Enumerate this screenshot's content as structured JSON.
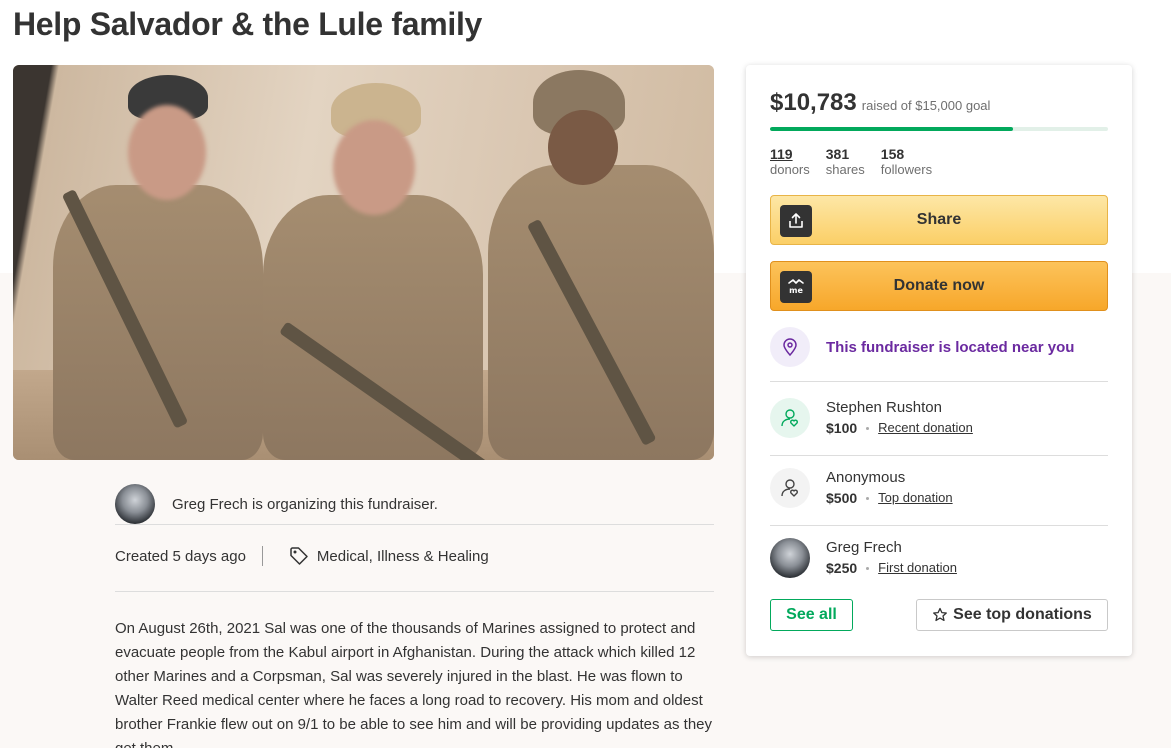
{
  "page": {
    "title": "Help Salvador & the Lule family"
  },
  "organizer": {
    "text": "Greg Frech is organizing this fundraiser."
  },
  "meta": {
    "created": "Created 5 days ago",
    "category": "Medical, Illness & Healing"
  },
  "story": {
    "text": "On August 26th, 2021 Sal was one of the thousands of Marines assigned to protect and evacuate people from the Kabul airport in Afghanistan. During the attack which killed 12 other Marines and a Corpsman, Sal was severely injured in the blast. He was flown to Walter Reed medical center where he faces a long road to recovery. His mom and oldest brother Frankie flew out on 9/1 to be able to see him and will be providing updates as they get them."
  },
  "card": {
    "raised_amount": "$10,783",
    "raised_goal": "raised of $15,000 goal",
    "progress_fraction": 0.719,
    "stats": [
      {
        "num": "119",
        "label": "donors"
      },
      {
        "num": "381",
        "label": "shares"
      },
      {
        "num": "158",
        "label": "followers"
      }
    ],
    "share_label": "Share",
    "donate_label": "Donate now",
    "near_label": "This fundraiser is located near you",
    "donations": [
      {
        "name": "Stephen Rushton",
        "amount": "$100",
        "tag": "Recent donation"
      },
      {
        "name": "Anonymous",
        "amount": "$500",
        "tag": "Top donation"
      },
      {
        "name": "Greg Frech",
        "amount": "$250",
        "tag": "First donation"
      }
    ],
    "see_all_label": "See all",
    "see_top_label": "See top donations"
  },
  "colors": {
    "accent_green": "#02a95c",
    "near_purple": "#6b2aa0",
    "donate_orange": "#f7a72a",
    "share_yellow": "#fbcf67"
  }
}
